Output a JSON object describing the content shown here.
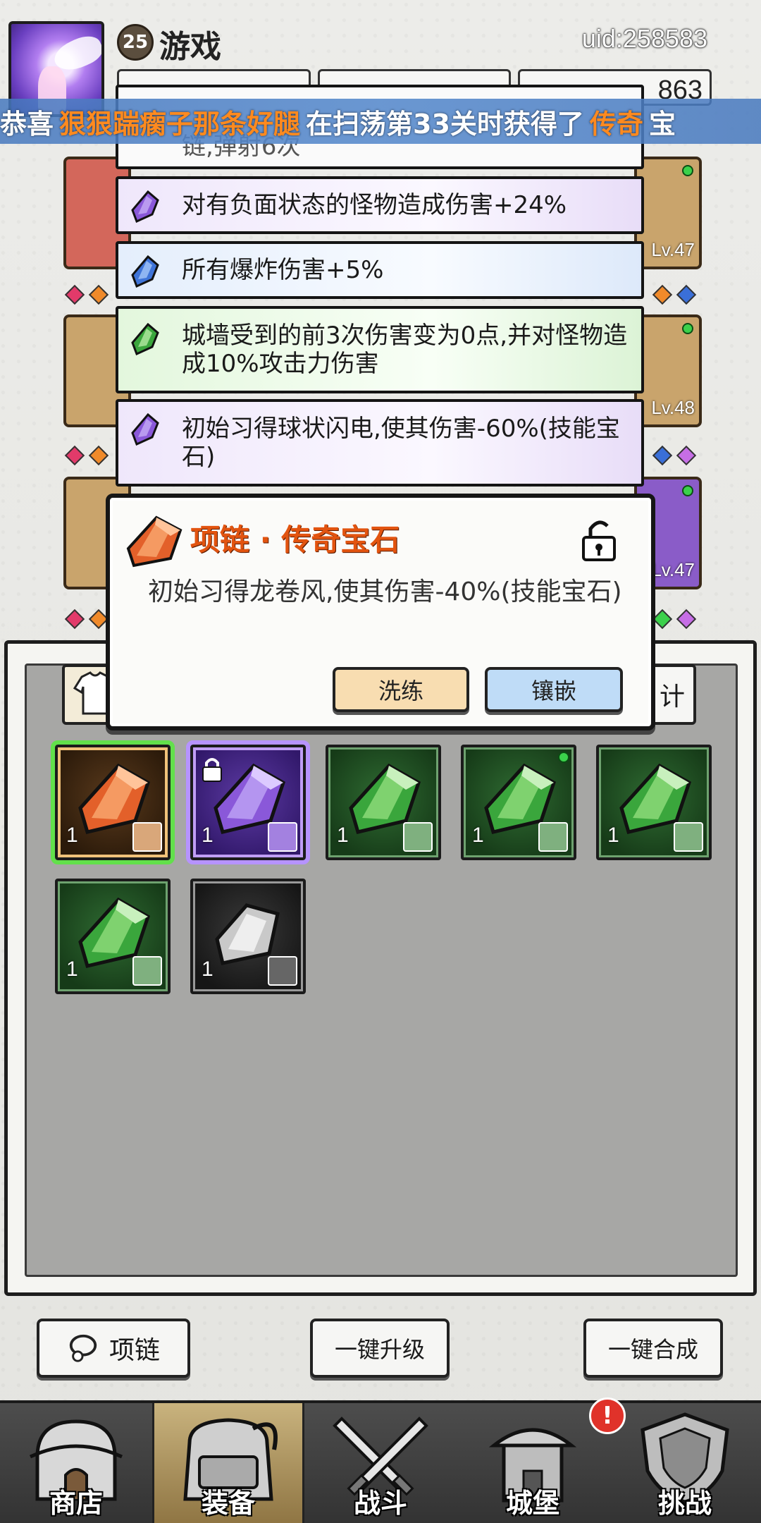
{
  "header": {
    "level": "25",
    "title": "游戏",
    "uid": "uid:258583",
    "currency_partial": "863"
  },
  "marquee": {
    "prefix": "恭喜",
    "player": "狠狠踹瘸子那条好腿",
    "middle": "在扫荡第33关时获得了",
    "item": "传奇",
    "suffix": "宝"
  },
  "background_equipment": {
    "levels": [
      "Lv.47",
      "Lv.48",
      "Lv.47"
    ]
  },
  "affixes": [
    {
      "color": "white",
      "text": "链,弹射6次"
    },
    {
      "color": "purple",
      "text": "对有负面状态的怪物造成伤害+24%"
    },
    {
      "color": "blue",
      "text": "所有爆炸伤害+5%"
    },
    {
      "color": "green",
      "text": "城墙受到的前3次伤害变为0点,并对怪物造成10%攻击力伤害"
    },
    {
      "color": "purple",
      "text": "初始习得球状闪电,使其伤害-60%(技能宝石)"
    }
  ],
  "popup": {
    "title": "项链 · 传奇宝石",
    "description": "初始习得龙卷风,使其伤害-40%(技能宝石)",
    "refine_label": "洗练",
    "inlay_label": "镶嵌",
    "lock_icon": "unlock-icon"
  },
  "inventory": {
    "filter_partial_label": "计",
    "gems": [
      {
        "rarity": "orange",
        "count": "1",
        "selected": true,
        "locked": false,
        "new": false
      },
      {
        "rarity": "purple",
        "count": "1",
        "selected": false,
        "locked": true,
        "new": false
      },
      {
        "rarity": "green",
        "count": "1",
        "selected": false,
        "locked": false,
        "new": false
      },
      {
        "rarity": "green",
        "count": "1",
        "selected": false,
        "locked": false,
        "new": true
      },
      {
        "rarity": "green",
        "count": "1",
        "selected": false,
        "locked": false,
        "new": false
      },
      {
        "rarity": "green",
        "count": "1",
        "selected": false,
        "locked": false,
        "new": false
      },
      {
        "rarity": "white",
        "count": "1",
        "selected": false,
        "locked": false,
        "new": false
      }
    ]
  },
  "actions": {
    "category_label": "项链",
    "upgrade_all_label": "一键升级",
    "merge_all_label": "一键合成"
  },
  "nav": {
    "items": [
      {
        "label": "商店",
        "icon": "shop-icon"
      },
      {
        "label": "装备",
        "icon": "backpack-icon",
        "active": true
      },
      {
        "label": "战斗",
        "icon": "swords-icon"
      },
      {
        "label": "城堡",
        "icon": "castle-icon",
        "alert": "!"
      },
      {
        "label": "挑战",
        "icon": "shield-icon"
      }
    ]
  },
  "colors": {
    "legendary": "#e25410",
    "epic": "#7a4fd0",
    "rare": "#3a6fd8",
    "uncommon": "#37a33a",
    "common": "#cfcfcf"
  }
}
